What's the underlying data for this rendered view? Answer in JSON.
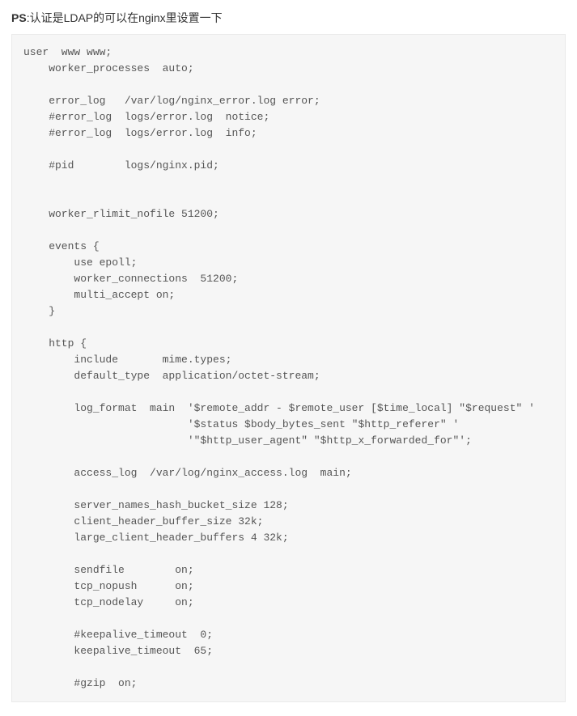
{
  "header": {
    "prefix": "PS",
    "text": ":认证是LDAP的可以在nginx里设置一下"
  },
  "code": {
    "content": "user  www www;\n    worker_processes  auto;\n\n    error_log   /var/log/nginx_error.log error;\n    #error_log  logs/error.log  notice;\n    #error_log  logs/error.log  info;\n\n    #pid        logs/nginx.pid;\n\n\n    worker_rlimit_nofile 51200;\n\n    events {\n        use epoll;\n        worker_connections  51200;\n        multi_accept on;\n    }\n\n    http {\n        include       mime.types;\n        default_type  application/octet-stream;\n\n        log_format  main  '$remote_addr - $remote_user [$time_local] \"$request\" '\n                          '$status $body_bytes_sent \"$http_referer\" '\n                          '\"$http_user_agent\" \"$http_x_forwarded_for\"';\n\n        access_log  /var/log/nginx_access.log  main;\n\n        server_names_hash_bucket_size 128;\n        client_header_buffer_size 32k;\n        large_client_header_buffers 4 32k;\n\n        sendfile        on;\n        tcp_nopush      on;\n        tcp_nodelay     on;\n\n        #keepalive_timeout  0;\n        keepalive_timeout  65;\n\n        #gzip  on;"
  }
}
